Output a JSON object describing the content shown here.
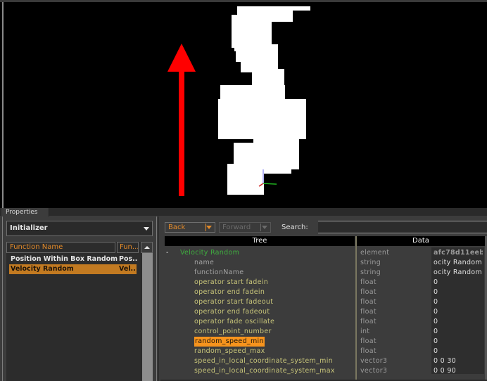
{
  "viewport": {
    "description": "3D particle preview: white particle sprites with red up-direction arrow and axis gizmo",
    "arrow_color": "#ff0000",
    "particle_color": "#ffffff"
  },
  "panel": {
    "tab_label": "Properties"
  },
  "left": {
    "category_select": "Initializer",
    "list_headers": [
      "Function Name",
      "Fun..."
    ],
    "rows": [
      {
        "name": "Position Within Box Random",
        "short": "Pos..",
        "selected": false
      },
      {
        "name": "Velocity Random",
        "short": "Vel..",
        "selected": true
      }
    ]
  },
  "right": {
    "back_label": "Back",
    "forward_label": "Forward",
    "search_label": "Search:",
    "search_value": "",
    "tree_header": "Tree",
    "data_header": "Data",
    "root": {
      "toggle": "-",
      "name": "Velocity Random",
      "type": "element",
      "value": "afc78d11eeb"
    },
    "properties": [
      {
        "name": "name",
        "type": "string",
        "value": "ocity Random",
        "style": "grey"
      },
      {
        "name": "functionName",
        "type": "string",
        "value": "ocity Random",
        "style": "grey"
      },
      {
        "name": "operator start fadein",
        "type": "float",
        "value": "0",
        "style": "normal"
      },
      {
        "name": "operator end fadein",
        "type": "float",
        "value": "0",
        "style": "normal"
      },
      {
        "name": "operator start fadeout",
        "type": "float",
        "value": "0",
        "style": "normal"
      },
      {
        "name": "operator end fadeout",
        "type": "float",
        "value": "0",
        "style": "normal"
      },
      {
        "name": "operator fade oscillate",
        "type": "float",
        "value": "0",
        "style": "normal"
      },
      {
        "name": "control_point_number",
        "type": "int",
        "value": "0",
        "style": "normal"
      },
      {
        "name": "random_speed_min",
        "type": "float",
        "value": "0",
        "style": "highlighted"
      },
      {
        "name": "random_speed_max",
        "type": "float",
        "value": "0",
        "style": "normal"
      },
      {
        "name": "speed_in_local_coordinate_system_min",
        "type": "vector3",
        "value": "0 0 30",
        "style": "normal"
      },
      {
        "name": "speed_in_local_coordinate_system_max",
        "type": "vector3",
        "value": "0 0 90",
        "style": "normal"
      }
    ]
  },
  "colors": {
    "accent_orange": "#e28a2a",
    "selection_orange": "#c27a21",
    "highlight_orange": "#f7941d",
    "tree_root_green": "#3fae3f",
    "property_text": "#c9c67a"
  }
}
